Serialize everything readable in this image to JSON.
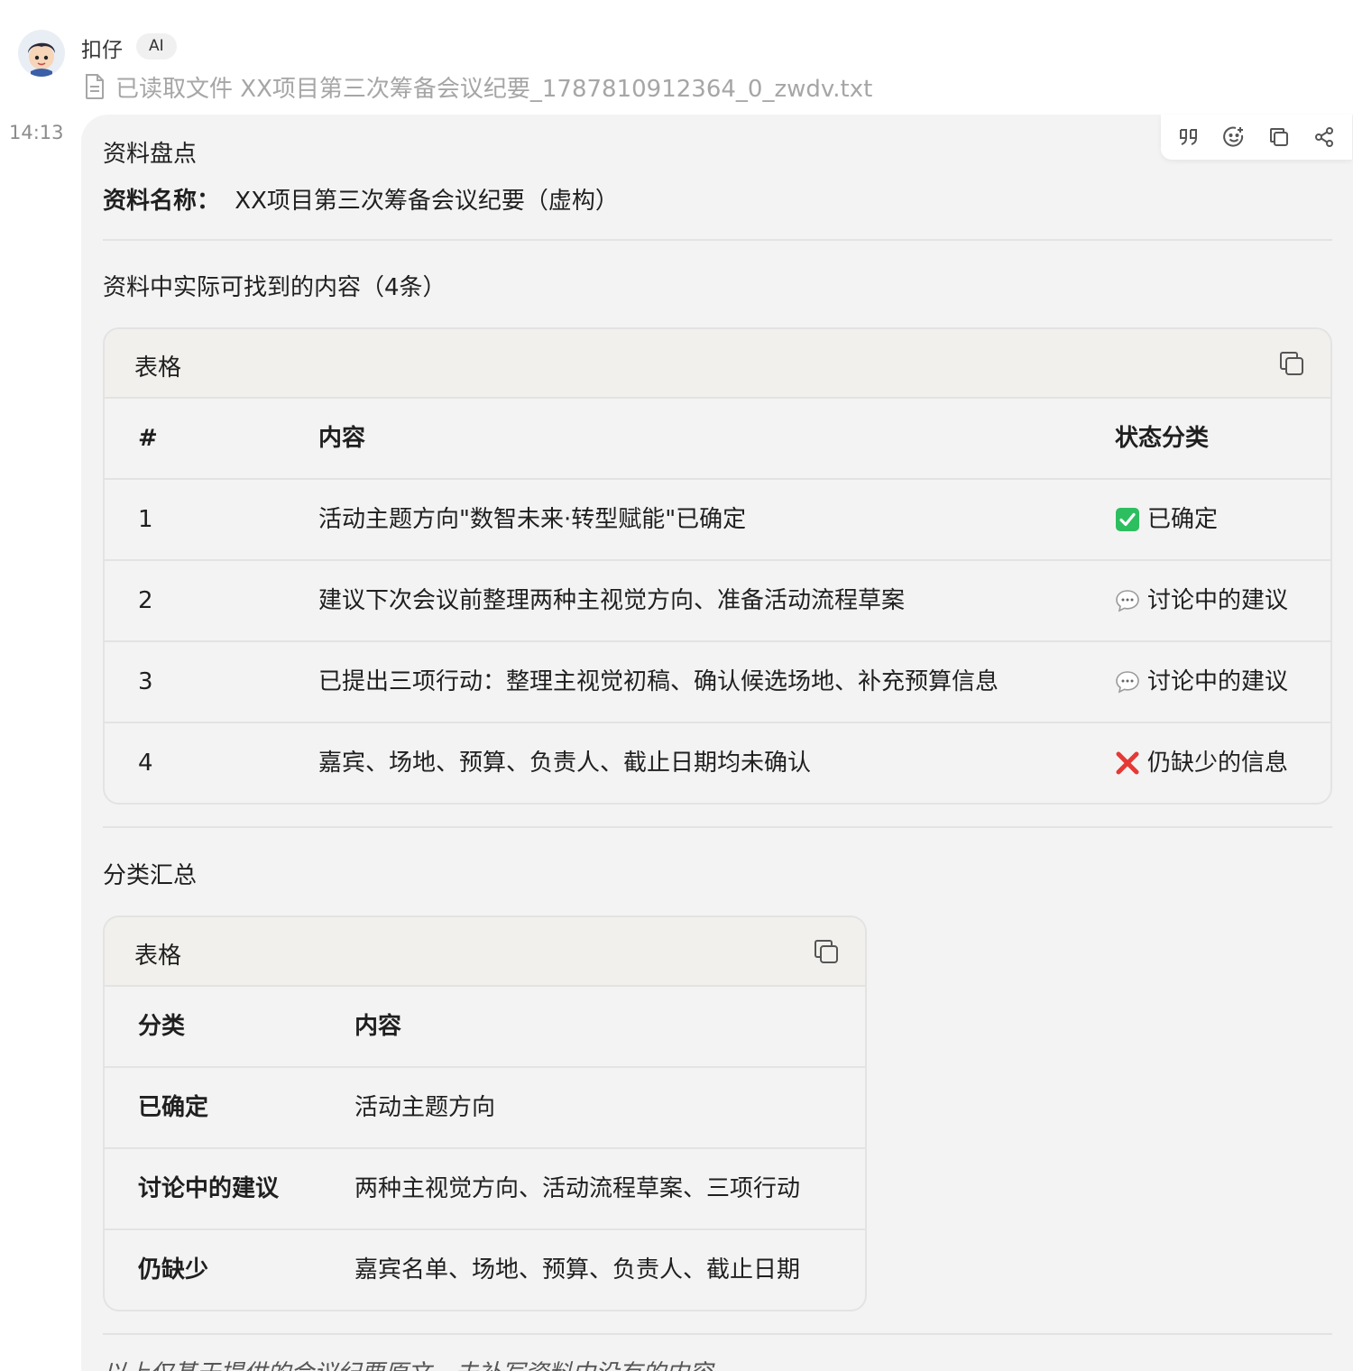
{
  "message": {
    "sender": "扣仔",
    "badge": "AI",
    "file_read_text": "已读取文件 XX项目第三次筹备会议纪要_1787810912364_0_zwdv.txt",
    "time": "14:13"
  },
  "content": {
    "heading": "资料盘点",
    "source_label": "资料名称：",
    "source_value": "XX项目第三次筹备会议纪要（虚构）",
    "found_title": "资料中实际可找到的内容（4条）",
    "summary_title": "分类汇总",
    "footer_text": "以上仅基于提供的会议纪要原文，未补写资料中没有的内容。"
  },
  "table1": {
    "label": "表格",
    "columns": [
      "#",
      "内容",
      "状态分类"
    ],
    "rows": [
      {
        "num": "1",
        "content": "活动主题方向\"数智未来·转型赋能\"已确定",
        "status": "已确定",
        "status_icon": "check-icon"
      },
      {
        "num": "2",
        "content": "建议下次会议前整理两种主视觉方向、准备活动流程草案",
        "status": "讨论中的建议",
        "status_icon": "speech-bubble-icon"
      },
      {
        "num": "3",
        "content": "已提出三项行动：整理主视觉初稿、确认候选场地、补充预算信息",
        "status": "讨论中的建议",
        "status_icon": "speech-bubble-icon"
      },
      {
        "num": "4",
        "content": "嘉宾、场地、预算、负责人、截止日期均未确认",
        "status": "仍缺少的信息",
        "status_icon": "cross-icon"
      }
    ]
  },
  "table2": {
    "label": "表格",
    "columns": [
      "分类",
      "内容"
    ],
    "rows": [
      {
        "category": "已确定",
        "content": "活动主题方向"
      },
      {
        "category": "讨论中的建议",
        "content": "两种主视觉方向、活动流程草案、三项行动"
      },
      {
        "category": "仍缺少",
        "content": "嘉宾名单、场地、预算、负责人、截止日期"
      }
    ]
  },
  "colors": {
    "check_green": "#2dbe60",
    "cross_red": "#e53935",
    "bubble_bg": "#f3f3f3"
  }
}
